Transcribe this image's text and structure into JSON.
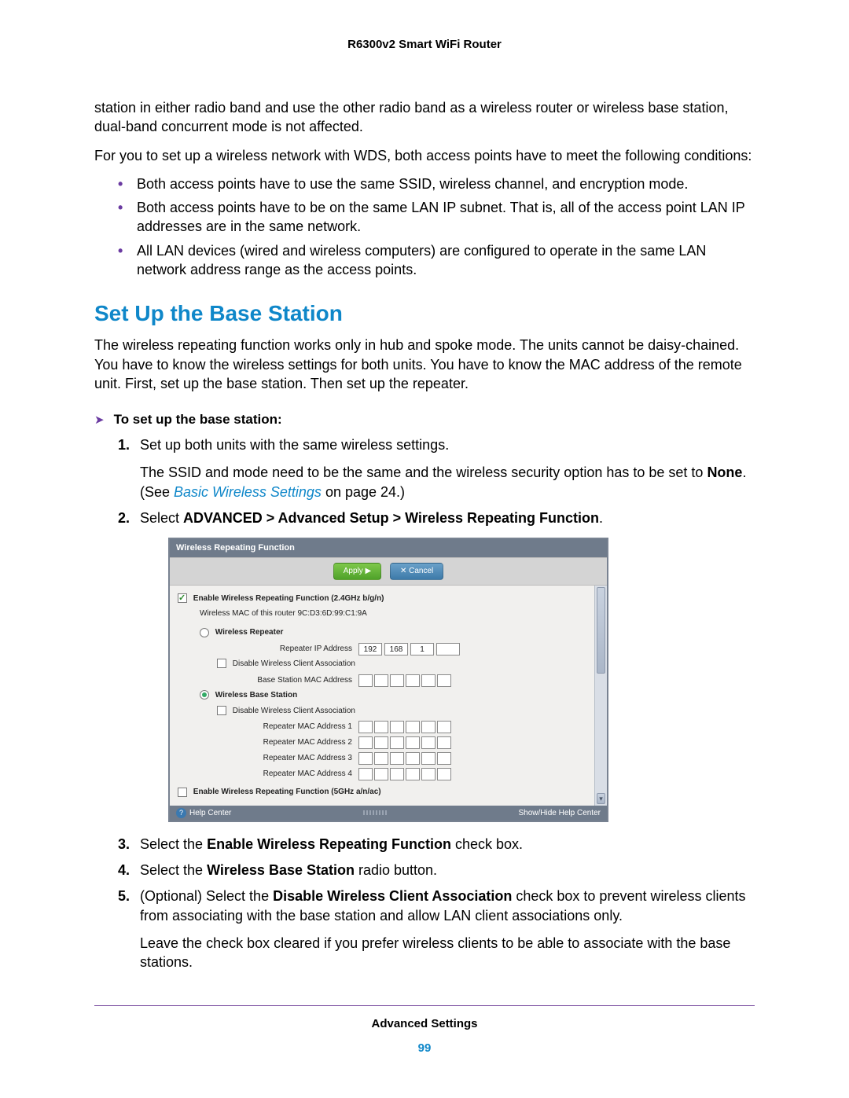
{
  "doc_title": "R6300v2 Smart WiFi Router",
  "intro_para": "station in either radio band and use the other radio band as a wireless router or wireless base station, dual-band concurrent mode is not affected.",
  "wds_lead": "For you to set up a wireless network with WDS, both access points have to meet the following conditions:",
  "wds_bullets": [
    "Both access points have to use the same SSID, wireless channel, and encryption mode.",
    "Both access points have to be on the same LAN IP subnet. That is, all of the access point LAN IP addresses are in the same network.",
    "All LAN devices (wired and wireless computers) are configured to operate in the same LAN network address range as the access points."
  ],
  "section_heading": "Set Up the Base Station",
  "section_para": "The wireless repeating function works only in hub and spoke mode. The units cannot be daisy-chained. You have to know the wireless settings for both units. You have to know the MAC address of the remote unit. First, set up the base station. Then set up the repeater.",
  "proc_lead": "To set up the base station:",
  "steps": {
    "s1_num": "1.",
    "s1_text": "Set up both units with the same wireless settings.",
    "s1_follow_pre": "The SSID and mode need to be the same and the wireless security option has to be set to ",
    "s1_follow_bold": "None",
    "s1_follow_mid": ". (See ",
    "s1_follow_link": "Basic Wireless Settings",
    "s1_follow_end": " on page 24.)",
    "s2_num": "2.",
    "s2_pre": "Select ",
    "s2_bold": "ADVANCED > Advanced Setup > Wireless Repeating Function",
    "s2_post": ".",
    "s3_num": "3.",
    "s3_pre": "Select the ",
    "s3_bold": "Enable Wireless Repeating Function",
    "s3_post": " check box.",
    "s4_num": "4.",
    "s4_pre": "Select the ",
    "s4_bold": "Wireless Base Station",
    "s4_post": " radio button.",
    "s5_num": "5.",
    "s5_pre": "(Optional) Select the ",
    "s5_bold": "Disable Wireless Client Association",
    "s5_post": " check box to prevent wireless clients from associating with the base station and allow LAN client associations only.",
    "s5_follow": "Leave the check box cleared if you prefer wireless clients to be able to associate with the base stations."
  },
  "shot": {
    "title": "Wireless Repeating Function",
    "apply": "Apply ▶",
    "cancel": "✕ Cancel",
    "enable24": "Enable Wireless Repeating Function (2.4GHz b/g/n)",
    "mac_line": "Wireless MAC of this router 9C:D3:6D:99:C1:9A",
    "repeater": "Wireless Repeater",
    "repeater_ip": "Repeater IP Address",
    "ip": {
      "a": "192",
      "b": "168",
      "c": "1",
      "d": ""
    },
    "disable_assoc": "Disable Wireless Client Association",
    "base_mac": "Base Station MAC Address",
    "base_station": "Wireless Base Station",
    "rep_mac1": "Repeater MAC Address 1",
    "rep_mac2": "Repeater MAC Address 2",
    "rep_mac3": "Repeater MAC Address 3",
    "rep_mac4": "Repeater MAC Address 4",
    "enable5": "Enable Wireless Repeating Function (5GHz a/n/ac)",
    "help": "Help Center",
    "showhide": "Show/Hide Help Center"
  },
  "footer_label": "Advanced Settings",
  "page_number": "99"
}
